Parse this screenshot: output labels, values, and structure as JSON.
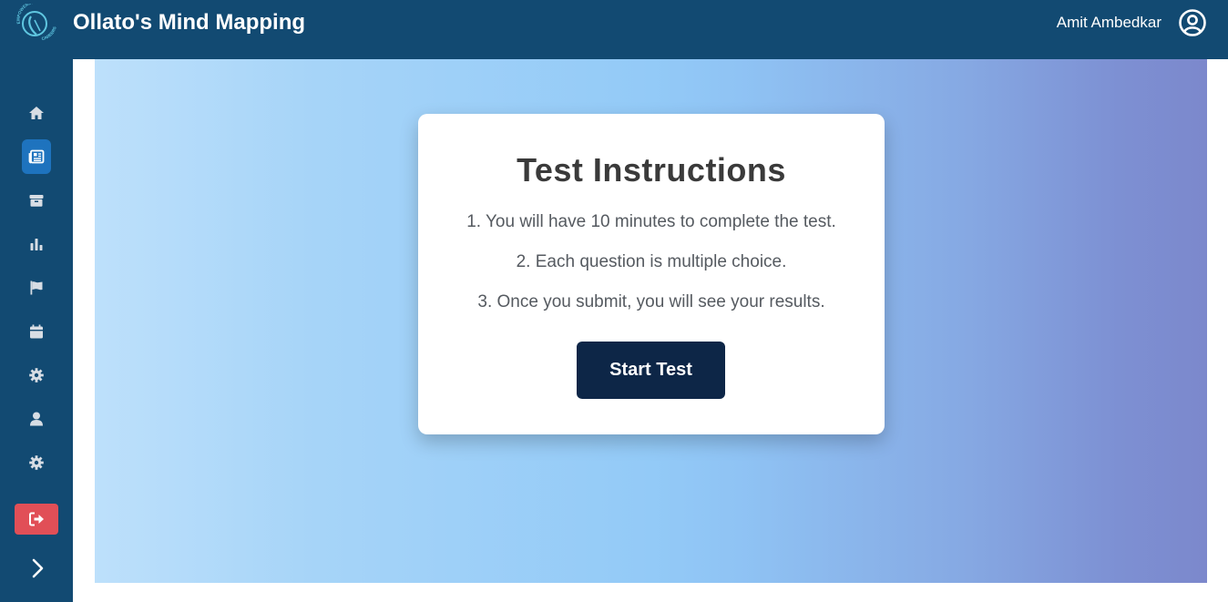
{
  "header": {
    "title": "Ollato's Mind Mapping",
    "user_name": "Amit Ambedkar",
    "logo_text_top": "EMPOWERING",
    "logo_text_bottom": "CAREERS",
    "user_icon": "user-circle-icon"
  },
  "sidebar": {
    "items": [
      {
        "name": "home",
        "icon": "home-icon",
        "active": false
      },
      {
        "name": "tests",
        "icon": "newspaper-icon",
        "active": true
      },
      {
        "name": "packages",
        "icon": "box-icon",
        "active": false
      },
      {
        "name": "reports",
        "icon": "bar-chart-icon",
        "active": false
      },
      {
        "name": "flags",
        "icon": "flag-icon",
        "active": false
      },
      {
        "name": "calendar",
        "icon": "calendar-icon",
        "active": false
      },
      {
        "name": "settings",
        "icon": "gear-icon",
        "active": false
      },
      {
        "name": "profile",
        "icon": "user-icon",
        "active": false
      },
      {
        "name": "preferences",
        "icon": "gear-icon",
        "active": false
      }
    ],
    "logout_icon": "logout-icon",
    "expand_icon": "chevron-right-icon"
  },
  "card": {
    "title": "Test Instructions",
    "instructions": [
      "1. You will have 10 minutes to complete the test.",
      "2. Each question is multiple choice.",
      "3. Once you submit, you will see your results."
    ],
    "button_label": "Start Test"
  },
  "colors": {
    "header_bg": "#124a72",
    "active_nav": "#1e73be",
    "logout_bg": "#e14f57",
    "button_bg": "#0d2647"
  }
}
